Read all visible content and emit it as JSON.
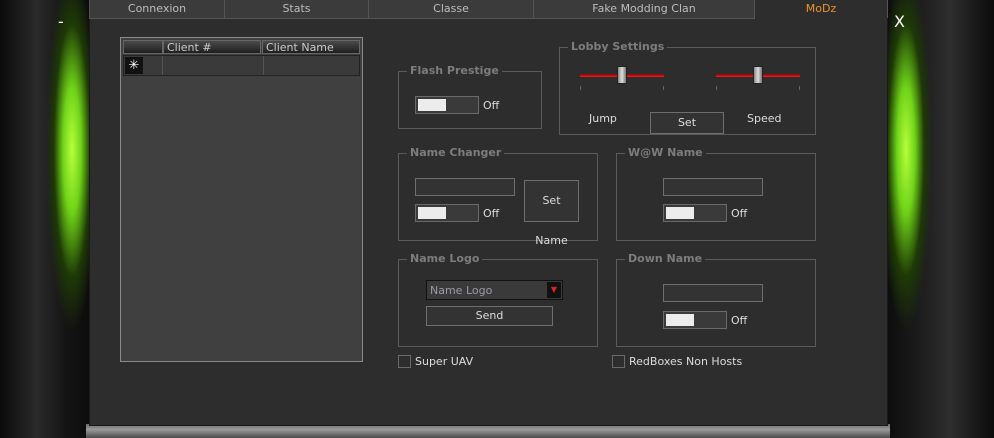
{
  "window": {
    "minimize": "-",
    "close": "X"
  },
  "tabs": [
    {
      "label": "Connexion"
    },
    {
      "label": "Stats"
    },
    {
      "label": "Classe"
    },
    {
      "label": "Fake Modding Clan"
    },
    {
      "label": "MoDz",
      "active": true
    }
  ],
  "client_list": {
    "columns": [
      "Client #",
      "Client Name"
    ],
    "new_row_marker": "✳"
  },
  "flash_prestige": {
    "title": "Flash Prestige",
    "toggle_label": "Off"
  },
  "lobby_settings": {
    "title": "Lobby Settings",
    "jump_label": "Jump",
    "speed_label": "Speed",
    "set_button": "Set"
  },
  "name_changer": {
    "title": "Name Changer",
    "toggle_label": "Off",
    "set_name_button": "Set Name"
  },
  "waw_name": {
    "title": "W@W Name",
    "toggle_label": "Off"
  },
  "name_logo": {
    "title": "Name Logo",
    "combo_value": "Name Logo",
    "send_button": "Send"
  },
  "down_name": {
    "title": "Down Name",
    "toggle_label": "Off"
  },
  "super_uav": {
    "label": "Super UAV"
  },
  "redboxes": {
    "label": "RedBoxes Non Hosts"
  },
  "colors": {
    "accent_tab": "#f0902c",
    "glow_green": "#8be11c",
    "slider_red": "#e22222"
  },
  "icons": {
    "combo_arrow": "caret-down-icon",
    "row_marker": "asterisk-icon"
  }
}
